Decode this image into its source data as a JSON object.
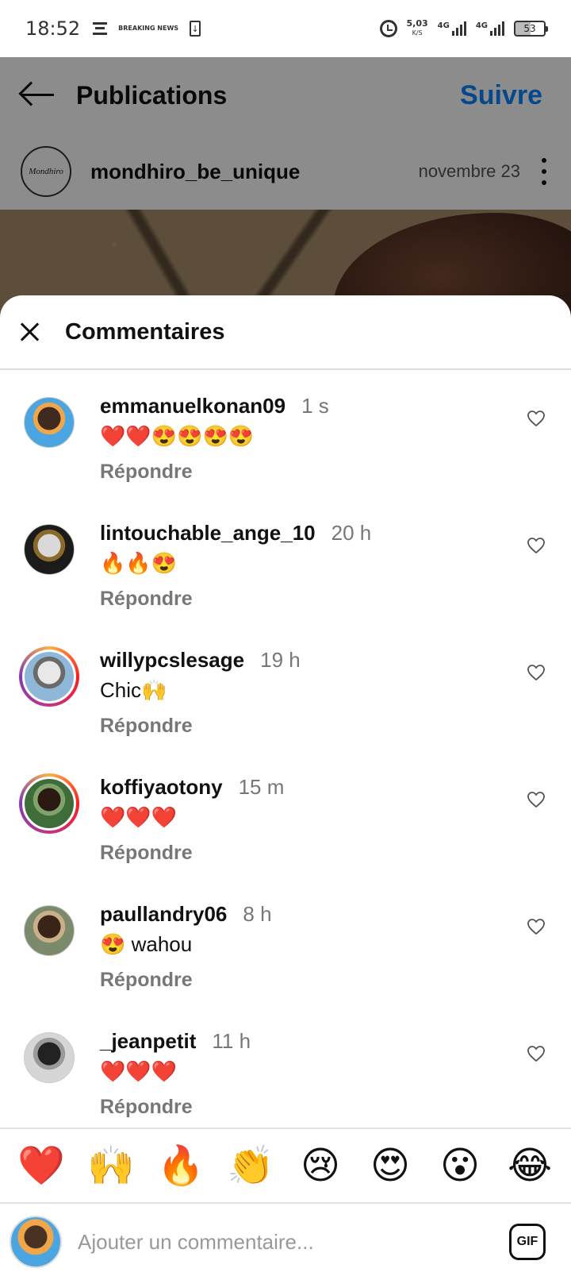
{
  "status_bar": {
    "time": "18:52",
    "news_label": "BREAKING NEWS",
    "speed_value": "5,03",
    "speed_unit": "K/S",
    "network_1": "4G",
    "network_2": "4G",
    "battery": "53"
  },
  "header": {
    "title": "Publications",
    "follow_label": "Suivre",
    "accent_color": "#0a84ff"
  },
  "post": {
    "username": "mondhiro_be_unique",
    "date": "novembre 23",
    "avatar_text": "Mondhiro"
  },
  "sheet": {
    "title": "Commentaires"
  },
  "comments": [
    {
      "username": "emmanuelkonan09",
      "time": "1 s",
      "text": "❤️❤️😍😍😍😍",
      "reply_label": "Répondre",
      "story_ring": false,
      "avatar_colors": [
        "#4aa5e0",
        "#3e2a1f",
        "#f2a64a"
      ]
    },
    {
      "username": "lintouchable_ange_10",
      "time": "20 h",
      "text": "🔥🔥😍",
      "reply_label": "Répondre",
      "story_ring": false,
      "avatar_colors": [
        "#1b1b1b",
        "#d9d9d9",
        "#8a6a2a"
      ]
    },
    {
      "username": "willypcslesage",
      "time": "19 h",
      "text": "Chic🙌",
      "reply_label": "Répondre",
      "story_ring": true,
      "avatar_colors": [
        "#8fb7d8",
        "#e8e8e8",
        "#6a6a6a"
      ]
    },
    {
      "username": "koffiyaotony",
      "time": "15 m",
      "text": "❤️❤️❤️",
      "reply_label": "Répondre",
      "story_ring": true,
      "avatar_colors": [
        "#3f6d3a",
        "#2a1a12",
        "#7fa36a"
      ]
    },
    {
      "username": "paullandry06",
      "time": "8 h",
      "text": "😍 wahou",
      "reply_label": "Répondre",
      "story_ring": false,
      "avatar_colors": [
        "#7a8a6a",
        "#3a2418",
        "#c9b08a"
      ]
    },
    {
      "username": "_jeanpetit",
      "time": "11 h",
      "text": "❤️❤️❤️",
      "reply_label": "Répondre",
      "story_ring": false,
      "avatar_colors": [
        "#d6d6d6",
        "#222222",
        "#9a9a9a"
      ]
    }
  ],
  "quick_reactions": [
    "❤️",
    "🙌",
    "🔥",
    "👏",
    "😢",
    "😍",
    "😮",
    "😂"
  ],
  "composer": {
    "placeholder": "Ajouter un commentaire...",
    "gif_label": "GIF"
  }
}
